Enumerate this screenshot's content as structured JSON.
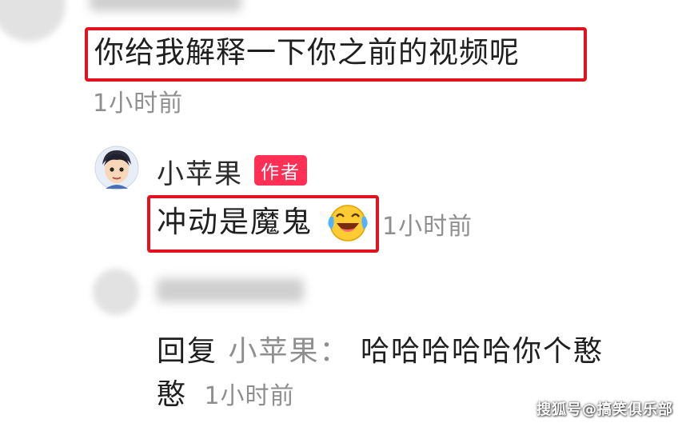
{
  "comment": {
    "text": "你给我解释一下你之前的视频呢",
    "time": "1小时前"
  },
  "reply1": {
    "username": "小苹果",
    "badge": "作者",
    "text": "冲动是魔鬼",
    "emoji_icon": "laughing-crying-face-icon",
    "time": "1小时前"
  },
  "reply2": {
    "prefix": "回复",
    "target": "小苹果：",
    "text_line1": "哈哈哈哈哈你个憨",
    "text_line2": "憨",
    "time": "1小时前"
  },
  "watermark": "搜狐号@搞笑俱乐部",
  "colors": {
    "highlight_border": "#e0141e",
    "badge_bg": "#ff2f55",
    "muted_text": "#8f8f8f"
  }
}
